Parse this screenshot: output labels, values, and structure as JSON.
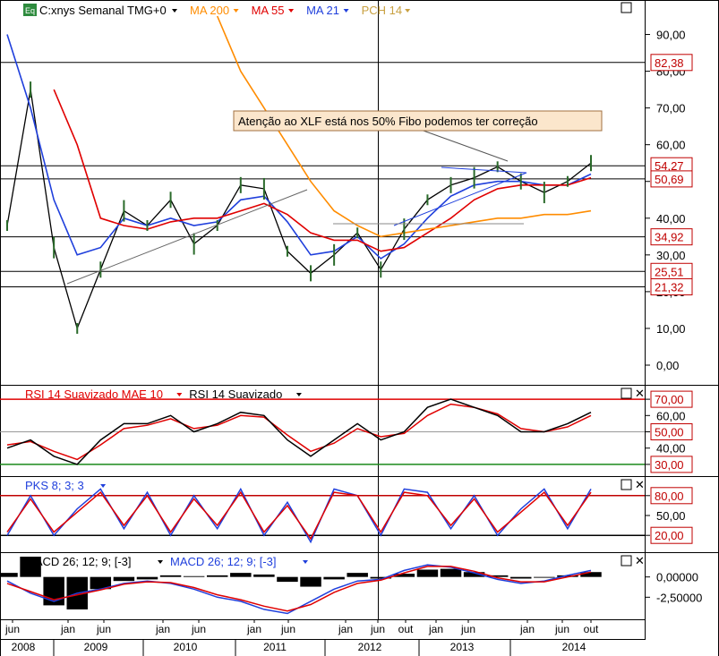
{
  "window": {
    "symbol_badge": "Eq",
    "price_legend": [
      {
        "text": "C:xnys Semanal TMG+0",
        "color": "#000000"
      },
      {
        "text": "MA 200",
        "color": "#ff8c00"
      },
      {
        "text": "MA 55",
        "color": "#e00000"
      },
      {
        "text": "MA 21",
        "color": "#1f3fdc"
      },
      {
        "text": "PCH 14",
        "color": "#c8a040"
      }
    ],
    "rsi_legend": [
      {
        "text": "RSI 14 Suavizado MAE 10",
        "color": "#e00000"
      },
      {
        "text": "RSI 14 Suavizado",
        "color": "#000000"
      }
    ],
    "pks_legend": [
      {
        "text": "PKS 8; 3; 3",
        "color": "#1f3fdc"
      }
    ],
    "macd_legend": [
      {
        "text": "MACD 26; 12; 9; [-3]",
        "color": "#000000"
      },
      {
        "text": "MACD 26; 12; 9; [-3]",
        "color": "#1f3fdc"
      }
    ]
  },
  "annotation": {
    "text": "Atenção ao XLF está nos 50% Fibo podemos ter correção"
  },
  "axes": {
    "price_ticks": [
      "90,00",
      "80,00",
      "70,00",
      "60,00",
      "50,00",
      "40,00",
      "30,00",
      "20,00",
      "10,00",
      "0,00"
    ],
    "price_levels": [
      "82,38",
      "54,27",
      "50,69",
      "34,92",
      "25,51",
      "21,32"
    ],
    "rsi_ticks": [
      "70,00",
      "60,00",
      "50,00",
      "40,00",
      "30,00"
    ],
    "pks_ticks": [
      "80,00",
      "50,00",
      "20,00"
    ],
    "macd_ticks": [
      "0,00000",
      "-2,50000"
    ],
    "months": [
      "jun",
      "jan",
      "jun",
      "jan",
      "jun",
      "jan",
      "jun",
      "jan",
      "jun",
      "out",
      "jan",
      "jun",
      "jan",
      "jun",
      "out"
    ],
    "years": [
      "2008",
      "2009",
      "2010",
      "2011",
      "2012",
      "2013",
      "2014"
    ]
  },
  "chart_data": {
    "type": "line",
    "title": "C:xnys Semanal TMG+0",
    "x": [
      "2008-06",
      "2008-10",
      "2009-01",
      "2009-03",
      "2009-06",
      "2009-10",
      "2010-01",
      "2010-04",
      "2010-07",
      "2010-10",
      "2011-01",
      "2011-04",
      "2011-07",
      "2011-10",
      "2012-01",
      "2012-04",
      "2012-07",
      "2012-10",
      "2013-01",
      "2013-04",
      "2013-07",
      "2013-10",
      "2014-01",
      "2014-04",
      "2014-07",
      "2014-10"
    ],
    "ylim": [
      0,
      95
    ],
    "series": [
      {
        "name": "C:xnys",
        "values": [
          38,
          75,
          32,
          10,
          26,
          42,
          38,
          45,
          33,
          38,
          49,
          48,
          31,
          25,
          30,
          36,
          26,
          37,
          45,
          49,
          51,
          54,
          50,
          47,
          50,
          55
        ]
      },
      {
        "name": "MA 21",
        "values": [
          90,
          70,
          45,
          30,
          32,
          40,
          38,
          40,
          38,
          39,
          45,
          46,
          39,
          30,
          31,
          35,
          29,
          33,
          40,
          46,
          49,
          50,
          50,
          49,
          49,
          52
        ]
      },
      {
        "name": "MA 55",
        "values": [
          null,
          null,
          75,
          60,
          40,
          38,
          37,
          39,
          40,
          40,
          42,
          44,
          41,
          36,
          34,
          34,
          31,
          32,
          36,
          40,
          45,
          48,
          49,
          49,
          49,
          51
        ]
      },
      {
        "name": "MA 200",
        "values": [
          null,
          null,
          null,
          null,
          null,
          null,
          null,
          null,
          null,
          95,
          80,
          70,
          60,
          50,
          42,
          38,
          35,
          36,
          37,
          38,
          39,
          40,
          40,
          41,
          41,
          42
        ]
      }
    ],
    "horizontal_levels": [
      82.38,
      54.27,
      50.69,
      34.92,
      25.51,
      21.32
    ],
    "rsi": {
      "ylim": [
        25,
        75
      ],
      "levels": [
        70,
        50,
        30
      ],
      "series": [
        {
          "name": "RSI 14 Suavizado",
          "values": [
            40,
            45,
            35,
            30,
            45,
            55,
            55,
            60,
            50,
            55,
            62,
            60,
            45,
            35,
            45,
            55,
            45,
            50,
            65,
            70,
            65,
            60,
            50,
            50,
            55,
            62
          ]
        },
        {
          "name": "RSI 14 Suavizado MAE 10",
          "values": [
            42,
            44,
            38,
            33,
            42,
            52,
            54,
            58,
            52,
            54,
            60,
            59,
            48,
            38,
            43,
            52,
            47,
            49,
            60,
            67,
            65,
            61,
            52,
            50,
            53,
            60
          ]
        }
      ]
    },
    "pks": {
      "ylim": [
        0,
        100
      ],
      "levels": [
        80,
        20
      ],
      "series": [
        {
          "name": "PKS 8; 3; 3",
          "values": [
            20,
            80,
            20,
            60,
            90,
            30,
            85,
            20,
            80,
            30,
            90,
            20,
            70,
            10,
            90,
            80,
            20,
            90,
            85,
            30,
            80,
            20,
            60,
            90,
            30,
            90
          ]
        },
        {
          "name": "PKS 8; 3; 3 signal",
          "values": [
            25,
            75,
            25,
            55,
            85,
            35,
            80,
            25,
            75,
            35,
            85,
            25,
            65,
            15,
            85,
            80,
            25,
            85,
            80,
            35,
            75,
            25,
            55,
            85,
            35,
            85
          ]
        }
      ]
    },
    "macd": {
      "ylim": [
        -5,
        2.5
      ],
      "series": [
        {
          "name": "MACD 26; 12; 9; [-3]",
          "values": [
            0.5,
            2.5,
            -3.5,
            -4,
            -1.5,
            -0.5,
            -0.3,
            0.2,
            0.1,
            0.2,
            0.5,
            0.3,
            -0.6,
            -1.2,
            -0.3,
            0.5,
            -0.2,
            0.4,
            0.9,
            1.0,
            0.6,
            0.2,
            -0.2,
            -0.1,
            0.2,
            0.6
          ]
        },
        {
          "name": "MACD 26; 12; 9; [-3] line",
          "values": [
            -0.5,
            -2,
            -3,
            -2,
            -1.5,
            -0.8,
            -0.5,
            -0.8,
            -1.5,
            -2.5,
            -3,
            -4,
            -4.5,
            -3,
            -1.5,
            -0.5,
            -0.3,
            0.8,
            1.5,
            1.2,
            0.5,
            -0.3,
            -0.8,
            -0.5,
            0.2,
            0.8
          ]
        },
        {
          "name": "MACD signal",
          "values": [
            -0.8,
            -1.8,
            -2.8,
            -2.2,
            -1.6,
            -0.9,
            -0.6,
            -0.7,
            -1.3,
            -2.2,
            -2.8,
            -3.6,
            -4.2,
            -3.4,
            -1.9,
            -0.8,
            -0.4,
            0.5,
            1.3,
            1.3,
            0.7,
            -0.1,
            -0.6,
            -0.6,
            0.0,
            0.6
          ]
        }
      ]
    }
  }
}
